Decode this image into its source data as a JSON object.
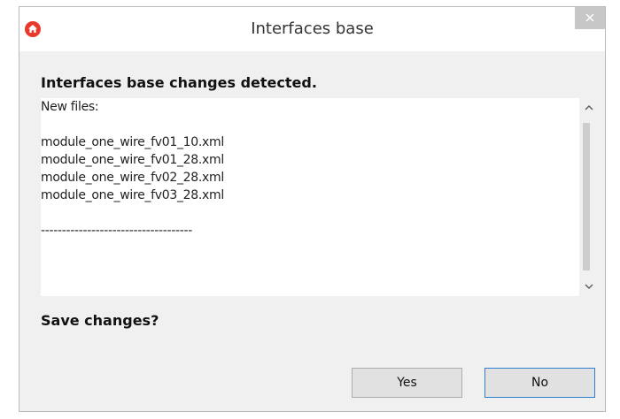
{
  "window": {
    "title": "Interfaces base",
    "close_label": "×",
    "app_icon": "home-icon",
    "accent_red": "#e8392a"
  },
  "dialog": {
    "header": "Interfaces base changes detected.",
    "content_lines": [
      "New files:",
      "",
      "module_one_wire_fv01_10.xml",
      "module_one_wire_fv01_28.xml",
      "module_one_wire_fv02_28.xml",
      "module_one_wire_fv03_28.xml",
      "",
      "------------------------------------"
    ],
    "scroll_up_icon": "chevron-up-icon",
    "scroll_down_icon": "chevron-down-icon",
    "question": "Save changes?",
    "yes_label": "Yes",
    "no_label": "No"
  }
}
